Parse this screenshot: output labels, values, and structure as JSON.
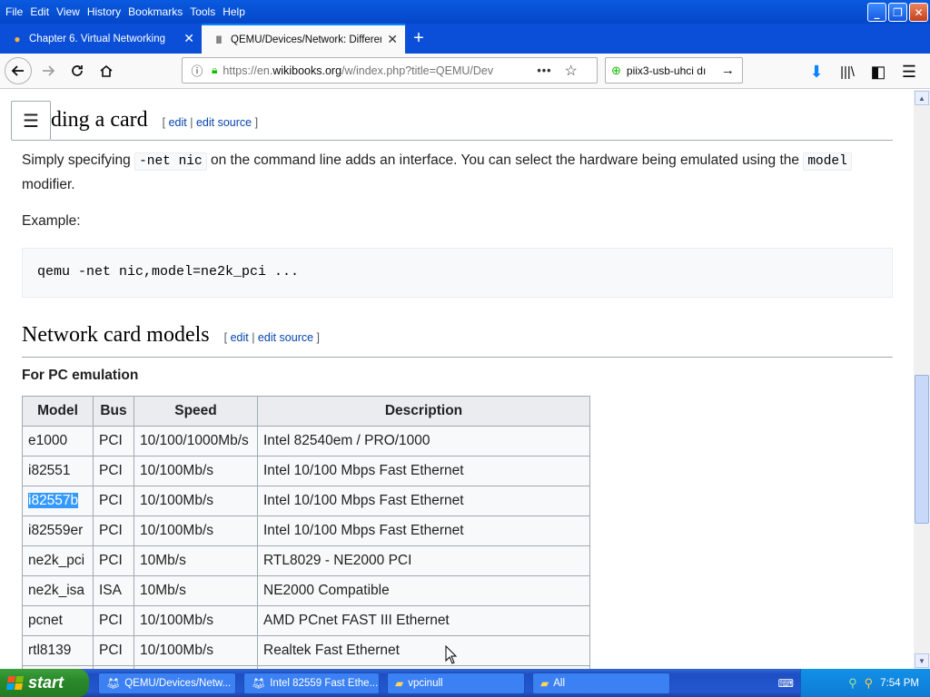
{
  "menu": [
    "File",
    "Edit",
    "View",
    "History",
    "Bookmarks",
    "Tools",
    "Help"
  ],
  "tabs": [
    {
      "title": "Chapter 6. Virtual Networking"
    },
    {
      "title": "QEMU/Devices/Network: Differen"
    }
  ],
  "nav": {
    "url_prefix": "https://en.",
    "url_domain": "wikibooks.org",
    "url_rest": "/w/index.php?title=QEMU/Dev",
    "search_value": "piix3-usb-uhci dı"
  },
  "page": {
    "section1_title": "ding a card",
    "edit": "edit",
    "edit_source": "edit source",
    "para1_a": "Simply specifying",
    "para1_code1": "-net nic",
    "para1_b": "on the command line adds an interface. You can select the hardware being emulated using the",
    "para1_code2": "model",
    "para1_c": "modifier.",
    "example_label": "Example:",
    "code_block": "qemu -net nic,model=ne2k_pci ...",
    "section2_title": "Network card models",
    "subsection": "For PC emulation",
    "table": {
      "headers": [
        "Model",
        "Bus",
        "Speed",
        "Description"
      ],
      "rows": [
        [
          "e1000",
          "PCI",
          "10/100/1000Mb/s",
          "Intel 82540em / PRO/1000"
        ],
        [
          "i82551",
          "PCI",
          "10/100Mb/s",
          "Intel 10/100 Mbps Fast Ethernet"
        ],
        [
          "i82557b",
          "PCI",
          "10/100Mb/s",
          "Intel 10/100 Mbps Fast Ethernet"
        ],
        [
          "i82559er",
          "PCI",
          "10/100Mb/s",
          "Intel 10/100 Mbps Fast Ethernet"
        ],
        [
          "ne2k_pci",
          "PCI",
          "10Mb/s",
          "RTL8029 - NE2000 PCI"
        ],
        [
          "ne2k_isa",
          "ISA",
          "10Mb/s",
          "NE2000 Compatible"
        ],
        [
          "pcnet",
          "PCI",
          "10/100Mb/s",
          "AMD PCnet FAST III Ethernet"
        ],
        [
          "rtl8139",
          "PCI",
          "10/100Mb/s",
          "Realtek Fast Ethernet"
        ]
      ]
    }
  },
  "taskbar": {
    "start": "start",
    "buttons": [
      "QEMU/Devices/Netw...",
      "Intel 82559 Fast Ethe...",
      "vpcinull",
      "All"
    ],
    "clock": "7:54 PM"
  },
  "colors": {
    "accent": "#0a84ff",
    "link": "#0645ad",
    "selection": "#3399ff"
  }
}
